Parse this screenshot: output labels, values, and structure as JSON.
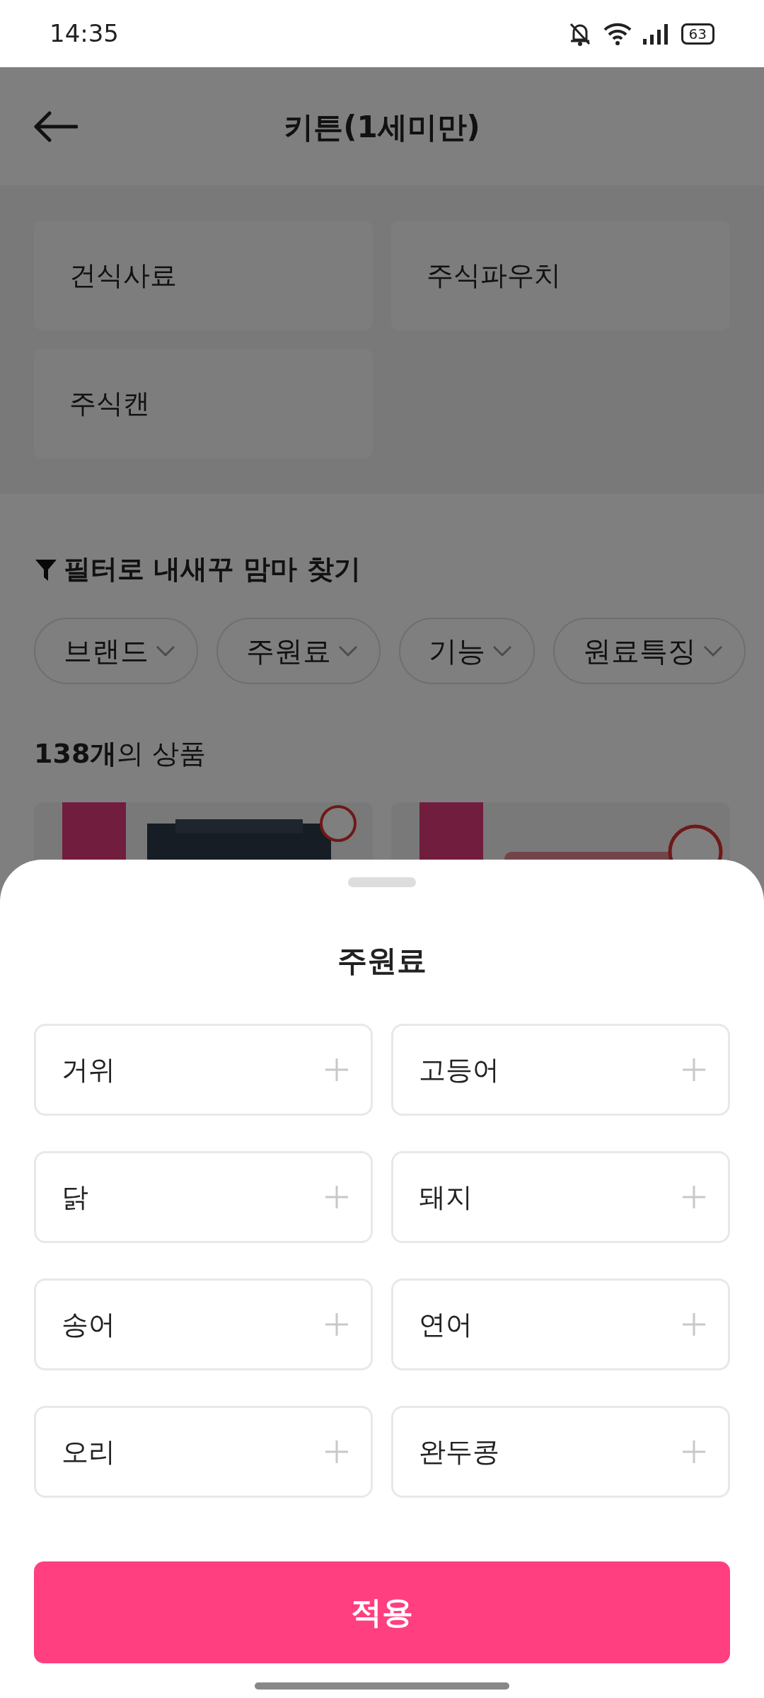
{
  "status_bar": {
    "time": "14:35",
    "battery": "63"
  },
  "header": {
    "title": "키튼(1세미만)"
  },
  "categories": [
    {
      "label": "건식사료"
    },
    {
      "label": "주식파우치"
    },
    {
      "label": "주식캔"
    }
  ],
  "filter": {
    "title": "필터로 내새꾸 맘마 찾기",
    "chips": [
      {
        "label": "브랜드"
      },
      {
        "label": "주원료"
      },
      {
        "label": "기능"
      },
      {
        "label": "원료특징"
      }
    ]
  },
  "product_count": "**138개**의 상품",
  "sheet": {
    "title": "주원료",
    "options": [
      {
        "label": "거위",
        "selected": false
      },
      {
        "label": "고등어",
        "selected": false
      },
      {
        "label": "닭",
        "selected": false
      },
      {
        "label": "돼지",
        "selected": false
      },
      {
        "label": "송어",
        "selected": false
      },
      {
        "label": "연어",
        "selected": false
      },
      {
        "label": "오리",
        "selected": false
      },
      {
        "label": "완두콩",
        "selected": false
      }
    ],
    "apply_button": "적용"
  }
}
